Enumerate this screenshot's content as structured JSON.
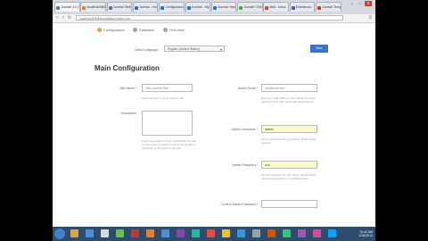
{
  "browser": {
    "tabs": [
      {
        "label": "Joomla! 3.x (TEMPLATE)",
        "color": "#5577aa"
      },
      {
        "label": "localhost/MMM - installation",
        "color": "#e08030"
      },
      {
        "label": "Joomla! Web Installer",
        "color": "#5577aa"
      },
      {
        "label": "Joomla! - Installer",
        "color": "#2277cc"
      },
      {
        "label": "Configuration - Joomla",
        "color": "#2277cc"
      },
      {
        "label": "Joomla! - My Joomla site",
        "color": "#2277cc"
      },
      {
        "label": "Joomla! Help - WWW",
        "color": "#2277cc"
      },
      {
        "label": "Joomla! CMS - Sprint",
        "color": "#44aa44"
      },
      {
        "label": "Mail - Inbox",
        "color": "#dd4433"
      },
      {
        "label": "Extensions",
        "color": "#3366bb"
      },
      {
        "label": "Joomla! Templates - MV",
        "color": "#cc3333"
      }
    ],
    "url": "localhost/MMM/installation/index.php",
    "minimize_label": "–",
    "maximize_label": "□",
    "close_label": "✕"
  },
  "steps": [
    {
      "label": "Configuration",
      "active": true
    },
    {
      "label": "Database",
      "active": false
    },
    {
      "label": "Overview",
      "active": false
    }
  ],
  "language": {
    "label": "Select Language",
    "value": "English (United States)"
  },
  "next_label": "Next",
  "heading": "Main Configuration",
  "left_fields": {
    "site_name": {
      "label": "Site Name *",
      "value": "Test Joomla Site",
      "help": "Enter the name of your Joomla site."
    },
    "description": {
      "label": "Description",
      "help": "Enter a description of the overall Web site that is to be used by search engines. Generally, a maximum of 20 words is optimal."
    }
  },
  "right_fields": {
    "admin_email": {
      "label": "Admin Email *",
      "value": "me@mail.com",
      "help": "Enter an email address. This will be the email address of the Web site Super Administrator."
    },
    "admin_username": {
      "label": "Admin Username *",
      "value": "admin",
      "help": "Set the username for your Super Administrator account."
    },
    "admin_password": {
      "label": "Admin Password *",
      "value": "•••••",
      "help": "Set the password for your Super Administrator account and confirm it in the field below."
    },
    "confirm_password": {
      "label": "Confirm Admin Password *",
      "value": ""
    }
  },
  "taskbar": {
    "icons": [
      "#e8a23a",
      "#4a90d9",
      "#d9d9d9",
      "#6bbf4e",
      "#c0392b",
      "#e67e22",
      "#4a90d9",
      "#8e44ad",
      "#1abc9c",
      "#e74c3c",
      "#f1c40f",
      "#3498db",
      "#95a5a6",
      "#d35400",
      "#2ecc71",
      "#9b59b6",
      "#e84393",
      "#00a8ff"
    ],
    "time": "10:42 AM",
    "date": "1/18/2014"
  }
}
